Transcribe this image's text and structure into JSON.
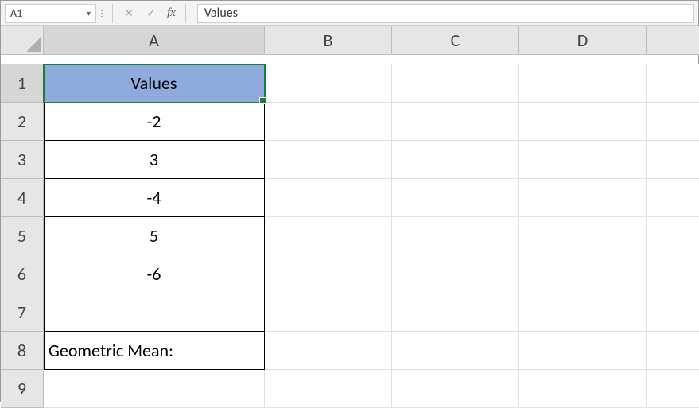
{
  "name_box": "A1",
  "formula_value": "Values",
  "columns": [
    "A",
    "B",
    "C",
    "D",
    ""
  ],
  "rows": [
    "1",
    "2",
    "3",
    "4",
    "5",
    "6",
    "7",
    "8",
    "9"
  ],
  "cells": {
    "A1": "Values",
    "A2": "-2",
    "A3": "3",
    "A4": "-4",
    "A5": "5",
    "A6": "-6",
    "A7": "",
    "A8": "Geometric Mean:",
    "A9": ""
  },
  "icons": {
    "cancel": "✕",
    "confirm": "✓",
    "fx": "fx",
    "dropdown": "▾"
  }
}
